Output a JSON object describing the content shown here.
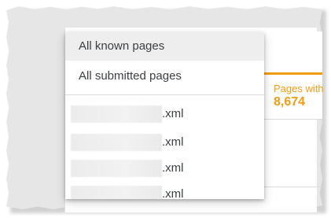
{
  "dropdown": {
    "items": [
      {
        "label": "All known pages",
        "selected": true
      },
      {
        "label": "All submitted pages",
        "selected": false
      }
    ],
    "sitemaps": [
      {
        "name": ".xml"
      },
      {
        "name": ".xml"
      },
      {
        "name": ".xml"
      },
      {
        "name": ".xml"
      }
    ]
  },
  "metric": {
    "label": "Pages with",
    "value": "8,674",
    "accent_color": "#f39c12"
  },
  "colors": {
    "menu_text": "#3c4043",
    "selected_bg": "#eeeeee",
    "background": "#e6e6e6"
  }
}
